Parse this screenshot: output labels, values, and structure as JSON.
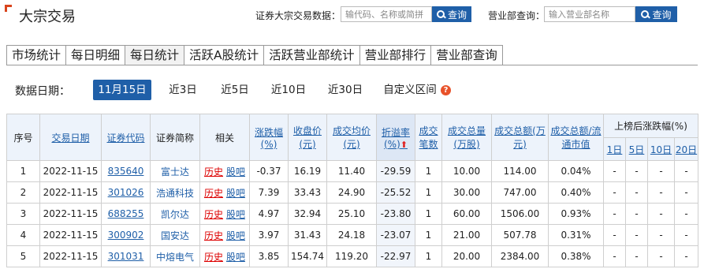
{
  "header": {
    "title": "大宗交易",
    "stock_search_label": "证券大宗交易数据：",
    "stock_search_placeholder": "输代码、名称或简拼",
    "stock_search_button": "查询",
    "dept_search_label": "营业部查询：",
    "dept_search_placeholder": "输入营业部名称",
    "dept_search_button": "查询"
  },
  "tabs": [
    "市场统计",
    "每日明细",
    "每日统计",
    "活跃A股统计",
    "活跃营业部统计",
    "营业部排行",
    "营业部查询"
  ],
  "active_tab": "每日统计",
  "date_filter": {
    "label": "数据日期：",
    "options": [
      "11月15日",
      "近3日",
      "近5日",
      "近10日",
      "近30日",
      "自定义区间"
    ],
    "active": "11月15日",
    "help_icon": "question-mark-icon"
  },
  "table": {
    "headers": {
      "seq": "序号",
      "date": "交易日期",
      "code": "证券代码",
      "name": "证券简称",
      "related": "相关",
      "change": "涨跌幅(%)",
      "close": "收盘价(元)",
      "avg_price": "成交均价(元)",
      "premium": "折溢率(%)",
      "count": "成交笔数",
      "volume": "成交总量(万股)",
      "amount": "成交总额(万元)",
      "ratio": "成交总额/流通市值",
      "after": "上榜后涨跌幅(%)",
      "d1": "1日",
      "d5": "5日",
      "d10": "10日",
      "d20": "20日"
    },
    "related_links": {
      "history": "历史",
      "bar": "股吧"
    },
    "rows": [
      {
        "seq": "1",
        "date": "2022-11-15",
        "code": "835640",
        "name": "富士达",
        "change": "-0.37",
        "close": "16.19",
        "avg": "11.40",
        "premium": "-29.59",
        "count": "1",
        "volume": "10.00",
        "amount": "114.00",
        "ratio": "0.04%",
        "d1": "-",
        "d5": "-",
        "d10": "-",
        "d20": "-"
      },
      {
        "seq": "2",
        "date": "2022-11-15",
        "code": "301026",
        "name": "浩通科技",
        "change": "7.39",
        "close": "33.43",
        "avg": "24.90",
        "premium": "-25.52",
        "count": "1",
        "volume": "30.00",
        "amount": "747.00",
        "ratio": "0.40%",
        "d1": "-",
        "d5": "-",
        "d10": "-",
        "d20": "-"
      },
      {
        "seq": "3",
        "date": "2022-11-15",
        "code": "688255",
        "name": "凯尔达",
        "change": "4.97",
        "close": "32.94",
        "avg": "25.10",
        "premium": "-23.80",
        "count": "1",
        "volume": "60.00",
        "amount": "1506.00",
        "ratio": "0.93%",
        "d1": "-",
        "d5": "-",
        "d10": "-",
        "d20": "-"
      },
      {
        "seq": "4",
        "date": "2022-11-15",
        "code": "300902",
        "name": "国安达",
        "change": "3.97",
        "close": "31.43",
        "avg": "24.18",
        "premium": "-23.07",
        "count": "1",
        "volume": "21.00",
        "amount": "507.78",
        "ratio": "0.31%",
        "d1": "-",
        "d5": "-",
        "d10": "-",
        "d20": "-"
      },
      {
        "seq": "5",
        "date": "2022-11-15",
        "code": "301031",
        "name": "中熔电气",
        "change": "3.85",
        "close": "154.74",
        "avg": "119.20",
        "premium": "-22.97",
        "count": "1",
        "volume": "20.00",
        "amount": "2384.00",
        "ratio": "0.38%",
        "d1": "-",
        "d5": "-",
        "d10": "-",
        "d20": "-"
      }
    ]
  },
  "colors": {
    "accent": "#1f5fa8",
    "up": "#e02020",
    "down": "#0a9a0a",
    "corner": "#d9441c"
  }
}
